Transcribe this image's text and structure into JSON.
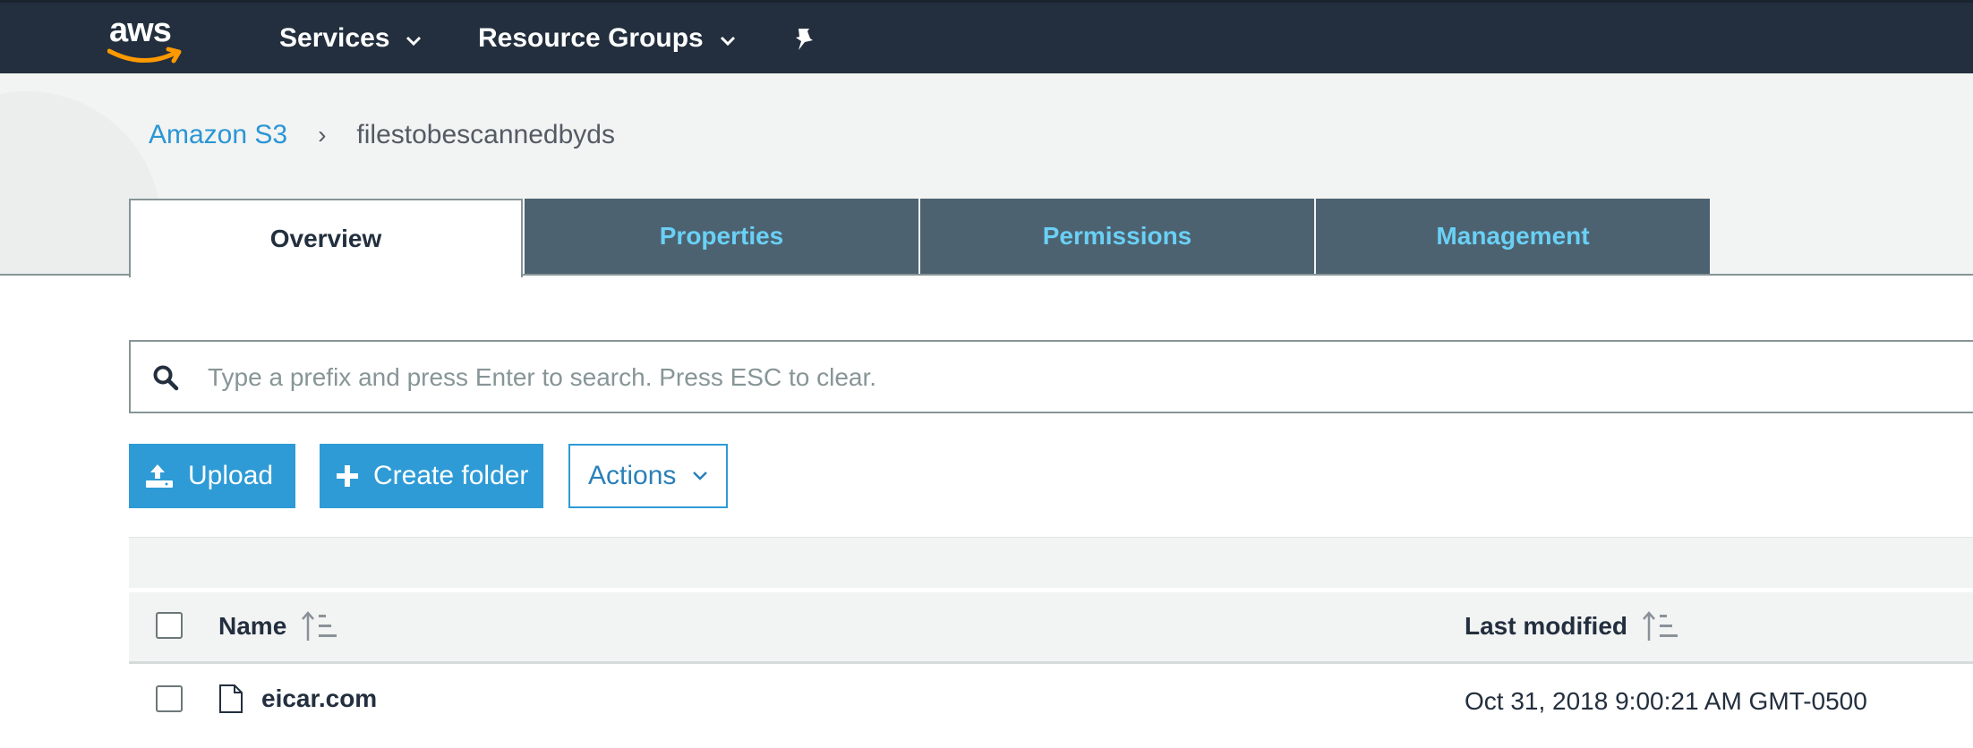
{
  "nav": {
    "logo": "aws",
    "services": "Services",
    "resource_groups": "Resource Groups",
    "pin_icon": "pin-icon"
  },
  "breadcrumb": {
    "root": "Amazon S3",
    "separator": "›",
    "current": "filestobescannedbyds"
  },
  "tabs": [
    {
      "label": "Overview",
      "active": true
    },
    {
      "label": "Properties",
      "active": false
    },
    {
      "label": "Permissions",
      "active": false
    },
    {
      "label": "Management",
      "active": false
    }
  ],
  "search": {
    "placeholder": "Type a prefix and press Enter to search. Press ESC to clear.",
    "value": ""
  },
  "toolbar": {
    "upload": "Upload",
    "create_folder": "Create folder",
    "actions": "Actions"
  },
  "table": {
    "columns": [
      "Name",
      "Last modified"
    ],
    "rows": [
      {
        "name": "eicar.com",
        "last_modified": "Oct 31, 2018 9:00:21 AM GMT-0500",
        "type": "file"
      }
    ]
  },
  "colors": {
    "nav_bg": "#232f3e",
    "tab_inactive_bg": "#4d6270",
    "tab_inactive_text": "#6ad0f5",
    "primary_button": "#2e9bd6",
    "link": "#2a96d4"
  }
}
